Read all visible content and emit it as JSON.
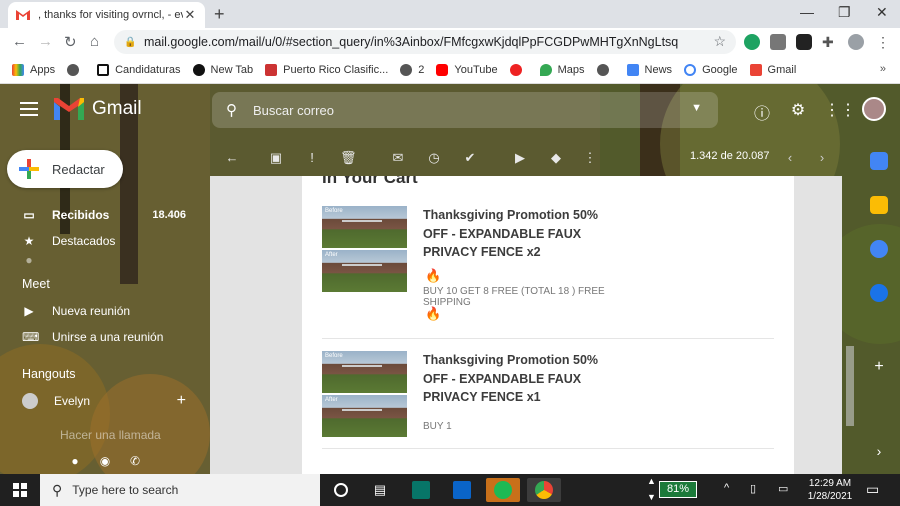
{
  "browser": {
    "tab_title": ", thanks for visiting ovrncl, - evely",
    "url": "mail.google.com/mail/u/0/#section_query/in%3Ainbox/FMfcgxwKjdqlPpFCGDPwMHTgXnNgLtsq",
    "bookmarks": [
      "Apps",
      "Candidaturas",
      "New Tab",
      "Puerto Rico Clasific...",
      "2",
      "YouTube",
      "Maps",
      "News",
      "Google",
      "Gmail"
    ],
    "more": "»"
  },
  "gmail": {
    "logo_text": "Gmail",
    "search_placeholder": "Buscar correo",
    "compose_label": "Redactar",
    "inbox_label": "Recibidos",
    "inbox_count": "18.406",
    "starred_label": "Destacados",
    "meet_header": "Meet",
    "new_meeting": "Nueva reunión",
    "join_meeting": "Unirse a una reunión",
    "hangouts_header": "Hangouts",
    "contact_name": "Evelyn",
    "make_call": "Hacer una llamada",
    "pager": "1.342 de 20.087",
    "colors": {
      "accent_red": "#ea4335",
      "fire": "#e8590c"
    }
  },
  "email": {
    "section_title": "In Your Cart",
    "items": [
      {
        "before_label": "Before",
        "after_label": "After",
        "name": "Thanksgiving Promotion 50% OFF - EXPANDABLE FAUX PRIVACY FENCE x2",
        "fire1": "🔥",
        "promo": "BUY 10 GET 8 FREE (TOTAL 18 ) FREE SHIPPING",
        "fire2": "🔥"
      },
      {
        "before_label": "Before",
        "after_label": "After",
        "name": "Thanksgiving Promotion 50% OFF - EXPANDABLE FAUX PRIVACY FENCE x1",
        "qty": "BUY 1"
      }
    ]
  },
  "taskbar": {
    "search_placeholder": "Type here to search",
    "battery": "81%",
    "time": "12:29 AM",
    "date": "1/28/2021"
  }
}
